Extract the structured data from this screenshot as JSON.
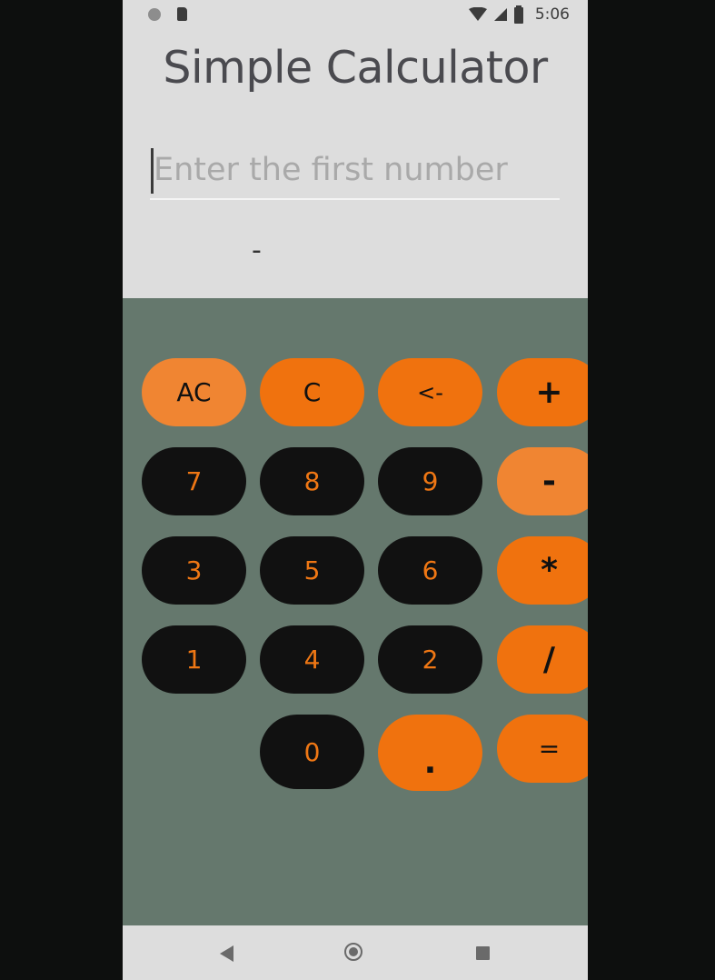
{
  "status_bar": {
    "time": "5:06"
  },
  "app": {
    "title": "Simple Calculator",
    "input_placeholder": "Enter the first number",
    "input_value": "",
    "result_text": "-"
  },
  "keypad": {
    "ac_label": "AC",
    "c_label": "C",
    "backspace_label": "<-",
    "plus_label": "+",
    "seven_label": "7",
    "eight_label": "8",
    "nine_label": "9",
    "minus_label": "-",
    "three_label": "3",
    "five_label": "5",
    "six_label": "6",
    "multiply_label": "*",
    "one_label": "1",
    "four_label": "4",
    "two_label": "2",
    "divide_label": "/",
    "zero_label": "0",
    "dot_label": ".",
    "equals_label": "="
  },
  "colors": {
    "background": "#dddddd",
    "keypad_background": "#65786d",
    "accent_orange": "#f0720e",
    "light_orange": "#f08532",
    "number_key": "#111111",
    "number_text": "#ef7714"
  },
  "nav_icons": [
    "back-icon",
    "home-icon",
    "recent-apps-icon"
  ]
}
